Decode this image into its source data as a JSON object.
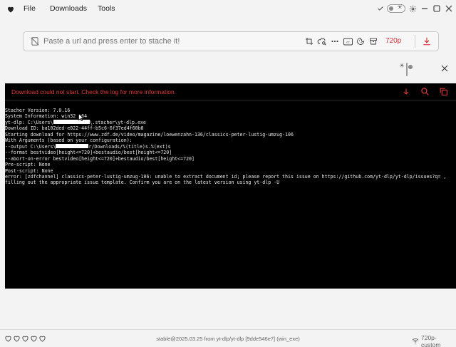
{
  "menu": {
    "file": "File",
    "downloads": "Downloads",
    "tools": "Tools"
  },
  "url_input": {
    "placeholder": "Paste a url and press enter to stache it!",
    "value": ""
  },
  "toolbar": {
    "resolution": "720p"
  },
  "console": {
    "error_banner": "Download could not start. Check the log for more information.",
    "lines": {
      "l1": "Stacher Version: 7.0.16",
      "l2": "System Information: win32 x64",
      "l3a": "yt-dlp: C:\\Users\\",
      "l3b": "\\.stacher\\yt-dlp.exe",
      "l4": "Download ID: ba102ded-e022-44ff-b5c6-6f37ed4f60b8",
      "l5": "Starting download for https://www.zdf.de/video/magazine/loewenzahn-136/classics-peter-lustig-umzug-106",
      "l6": "With Arguments (based on your configuration):",
      "l7a": "--output C:\\Users\\",
      "l7b": "r/Downloads/%(title)s.%(ext)s",
      "l8": "--format bestvideo[height<=720]+bestaudio/best[height<=720]",
      "l9": "--abort-on-error bestvideo[height<=720]+bestaudio/best[height<=720]",
      "l10": "Pre-script: None",
      "l11": "Post-script: None",
      "l12": "error: [zdfchannel] classics-peter-lustig-umzug-106: unable to extract document id; please report this issue on https://github.com/yt-dlp/yt-dlp/issues?q= ,",
      "l13": "filling out the appropriate issue template. Confirm you are on the latest version using yt-dlp -U"
    }
  },
  "footer": {
    "version": "stable@2025.03.25 from yt-dlp/yt-dlp [9dde546e7] (win_exe)",
    "preset": "720p-custom"
  },
  "colors": {
    "accent_red": "#e23b3b",
    "console_bg": "#000000"
  },
  "icons": [
    "heart-icon",
    "check-icon",
    "theme-toggle",
    "gear-icon",
    "minimize-icon",
    "maximize-icon",
    "close-icon",
    "link-off-icon",
    "crop-icon",
    "cloud-search-icon",
    "more-icon",
    "cc-icon",
    "cookie-icon",
    "archive-icon",
    "download-icon",
    "search-icon",
    "copy-icon",
    "wifi-icon"
  ]
}
